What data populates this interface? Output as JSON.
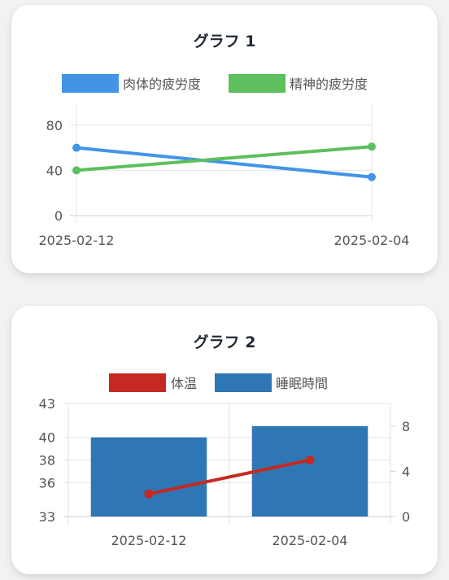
{
  "cards": [
    {
      "title": "グラフ 1"
    },
    {
      "title": "グラフ 2"
    }
  ],
  "chart_data": [
    {
      "type": "line",
      "title": "グラフ 1",
      "x": [
        "2025-02-12",
        "2025-02-04"
      ],
      "ylim": [
        0,
        100
      ],
      "y_ticks": [
        0,
        40,
        80
      ],
      "grid": true,
      "legend": "top",
      "series": [
        {
          "name": "肉体的疲労度",
          "values": [
            60,
            34
          ],
          "color": "#4294e6"
        },
        {
          "name": "精神的疲労度",
          "values": [
            40,
            61
          ],
          "color": "#5dbf5d"
        }
      ]
    },
    {
      "type": "bar",
      "title": "グラフ 2",
      "categories": [
        "2025-02-12",
        "2025-02-04"
      ],
      "legend": "top",
      "grid": true,
      "y_left": {
        "ylim": [
          33,
          43
        ],
        "ticks": [
          33,
          36,
          38,
          40,
          43
        ]
      },
      "y_right": {
        "ylim": [
          0,
          10
        ],
        "ticks": [
          0,
          4,
          8
        ]
      },
      "series": [
        {
          "name": "体温",
          "kind": "line",
          "axis": "left",
          "values": [
            35,
            38
          ],
          "color": "#c42a22"
        },
        {
          "name": "睡眠時間",
          "kind": "bar",
          "axis": "right",
          "values": [
            7,
            8
          ],
          "color": "#2f77b4"
        }
      ]
    }
  ]
}
